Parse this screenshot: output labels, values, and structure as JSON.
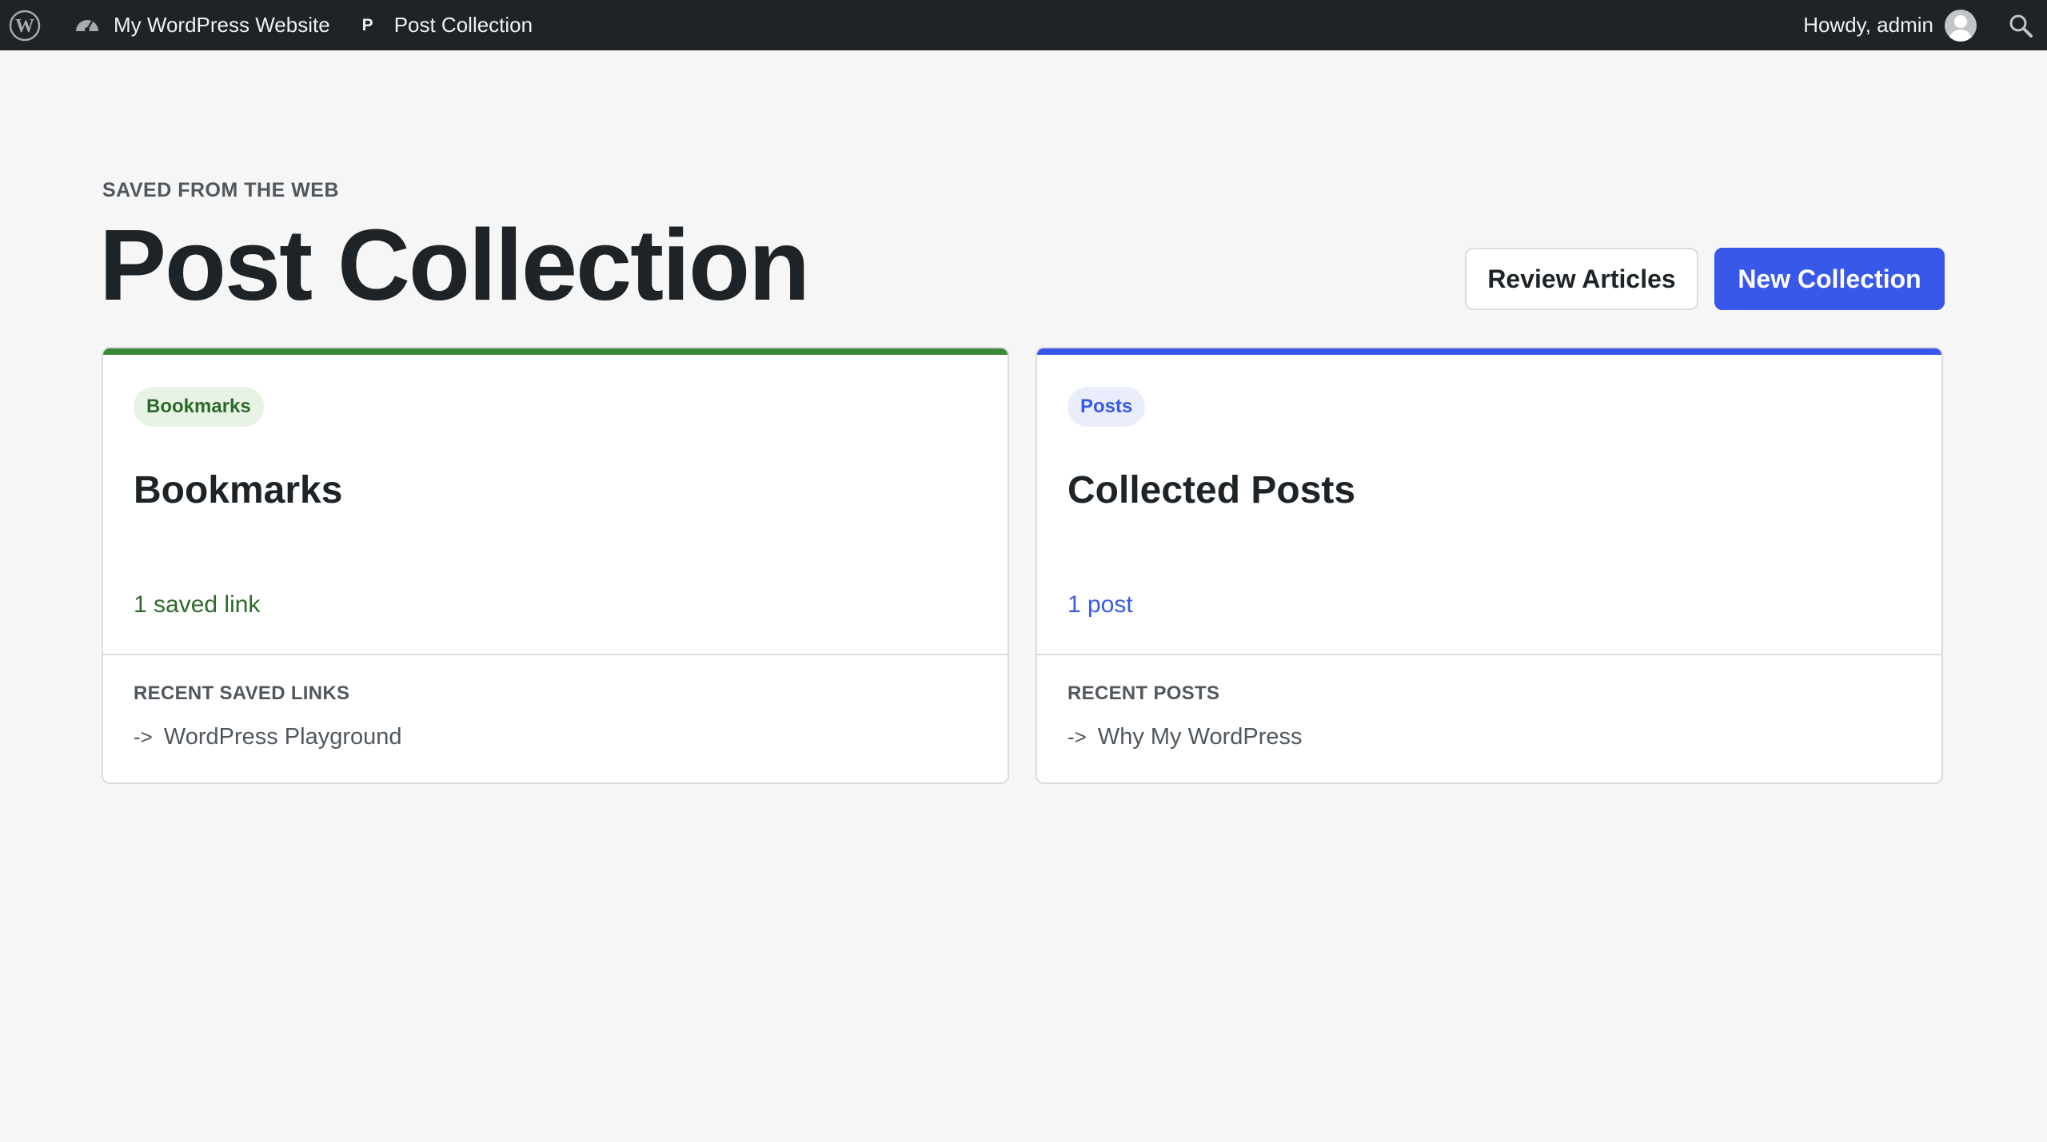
{
  "admin_bar": {
    "site_name": "My WordPress Website",
    "plugin_glyph": "P",
    "plugin_name": "Post Collection",
    "greeting": "Howdy, admin",
    "icons": [
      "wordpress-logo-icon",
      "dashboard-icon",
      "avatar",
      "search-icon"
    ]
  },
  "header": {
    "eyebrow": "SAVED FROM THE WEB",
    "title": "Post Collection",
    "review_button": "Review Articles",
    "new_button": "New Collection"
  },
  "colors": {
    "admin_bar": "#1d2327",
    "primary": "#3858e9",
    "green": "#3a8a35",
    "page_bg": "#f5f6f5"
  },
  "cards": [
    {
      "badge": "Bookmarks",
      "title": "Bookmarks",
      "count": "1 saved link",
      "recent_label": "RECENT SAVED LINKS",
      "arrow": "->",
      "recent_item": "WordPress Playground",
      "accent": "#3a8a35"
    },
    {
      "badge": "Posts",
      "title": "Collected Posts",
      "count": "1 post",
      "recent_label": "RECENT POSTS",
      "arrow": "->",
      "recent_item": "Why My WordPress",
      "accent": "#3858e9"
    }
  ]
}
